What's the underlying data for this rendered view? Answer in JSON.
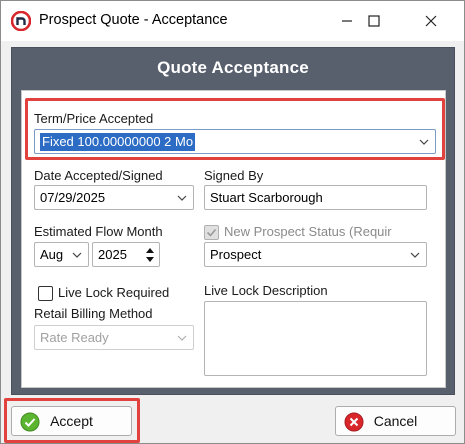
{
  "window": {
    "title": "Prospect Quote - Acceptance",
    "controls": {
      "minimize": "minimize",
      "maximize": "maximize",
      "close": "close"
    }
  },
  "panel": {
    "title": "Quote Acceptance"
  },
  "form": {
    "term_price": {
      "label": "Term/Price Accepted",
      "value": "Fixed 100.00000000 2 Mo"
    },
    "date_accepted": {
      "label": "Date Accepted/Signed",
      "value": "07/29/2025"
    },
    "signed_by": {
      "label": "Signed By",
      "value": "Stuart Scarborough"
    },
    "flow_month": {
      "label": "Estimated Flow Month",
      "month": "Aug",
      "year": "2025"
    },
    "new_status": {
      "label": "New Prospect Status (Requir",
      "checked": true,
      "enabled": false,
      "value": "Prospect"
    },
    "live_lock_required": {
      "label": "Live Lock Required",
      "checked": false
    },
    "live_lock_description": {
      "label": "Live Lock Description",
      "value": ""
    },
    "retail_billing": {
      "label": "Retail Billing Method",
      "value": "Rate Ready",
      "enabled": false
    }
  },
  "buttons": {
    "accept": "Accept",
    "cancel": "Cancel"
  },
  "colors": {
    "panel": "#58606e",
    "highlight": "#e2423e",
    "selection": "#2c6cc4",
    "accept_icon": "#5cb531",
    "cancel_icon": "#d9262b"
  }
}
